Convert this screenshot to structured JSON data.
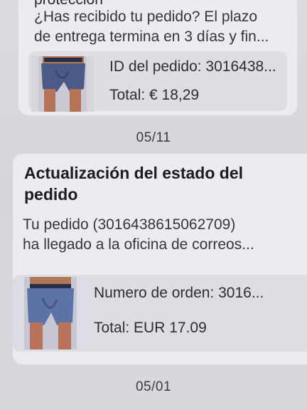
{
  "messages": [
    {
      "clipped_title": "protección",
      "body_lines": [
        "¿Has recibido tu pedido? El plazo",
        "de entrega termina en 3 días y fin..."
      ],
      "order": {
        "id_text": "ID del pedido: 3016438...",
        "total_text": "Total: € 18,29"
      }
    },
    {
      "date": "05/11",
      "title": "Actualización del estado del pedido",
      "body_lines": [
        "Tu pedido (3016438615062709)",
        "ha llegado a la oficina de correos..."
      ],
      "order": {
        "id_text": "Numero de orden: 3016...",
        "total_text": "Total:  EUR 17.09"
      }
    }
  ],
  "bottom_date": "05/01",
  "colors": {
    "card_bg": "#ecebef",
    "order_box_bg": "#dedde3",
    "screen_bg": "#d9d8de"
  },
  "icons": {
    "product_thumbnail": "underwear-product-photo"
  }
}
